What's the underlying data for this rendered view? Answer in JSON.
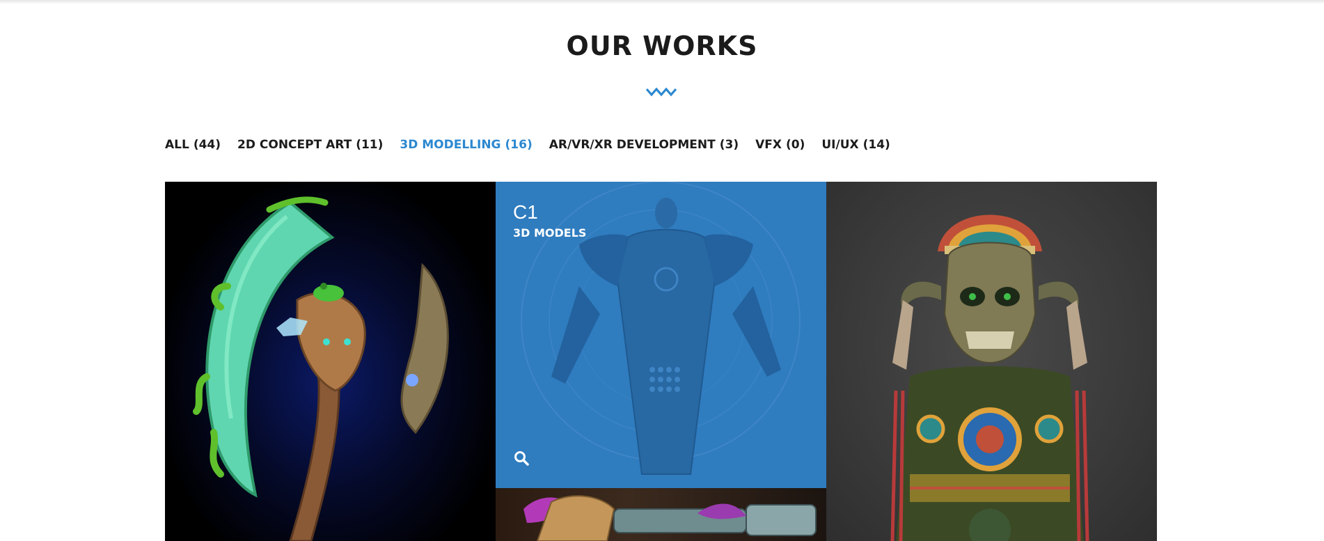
{
  "section": {
    "title": "OUR WORKS",
    "divider_icon": "zigzag-wave-icon",
    "accent_color": "#2c88d0"
  },
  "filters": [
    {
      "label": "ALL",
      "count": "(44)",
      "active": false
    },
    {
      "label": "2D CONCEPT ART",
      "count": "(11)",
      "active": false
    },
    {
      "label": "3D MODELLING",
      "count": "(16)",
      "active": true
    },
    {
      "label": "AR/VR/XR DEVELOPMENT",
      "count": "(3)",
      "active": false
    },
    {
      "label": "VFX",
      "count": "(0)",
      "active": false
    },
    {
      "label": "UI/UX",
      "count": "(14)",
      "active": false
    }
  ],
  "portfolio": {
    "hovered_item": {
      "title": "C1",
      "category": "3D MODELS",
      "icon": "search-icon",
      "overlay_color": "#2f7cbf"
    }
  }
}
